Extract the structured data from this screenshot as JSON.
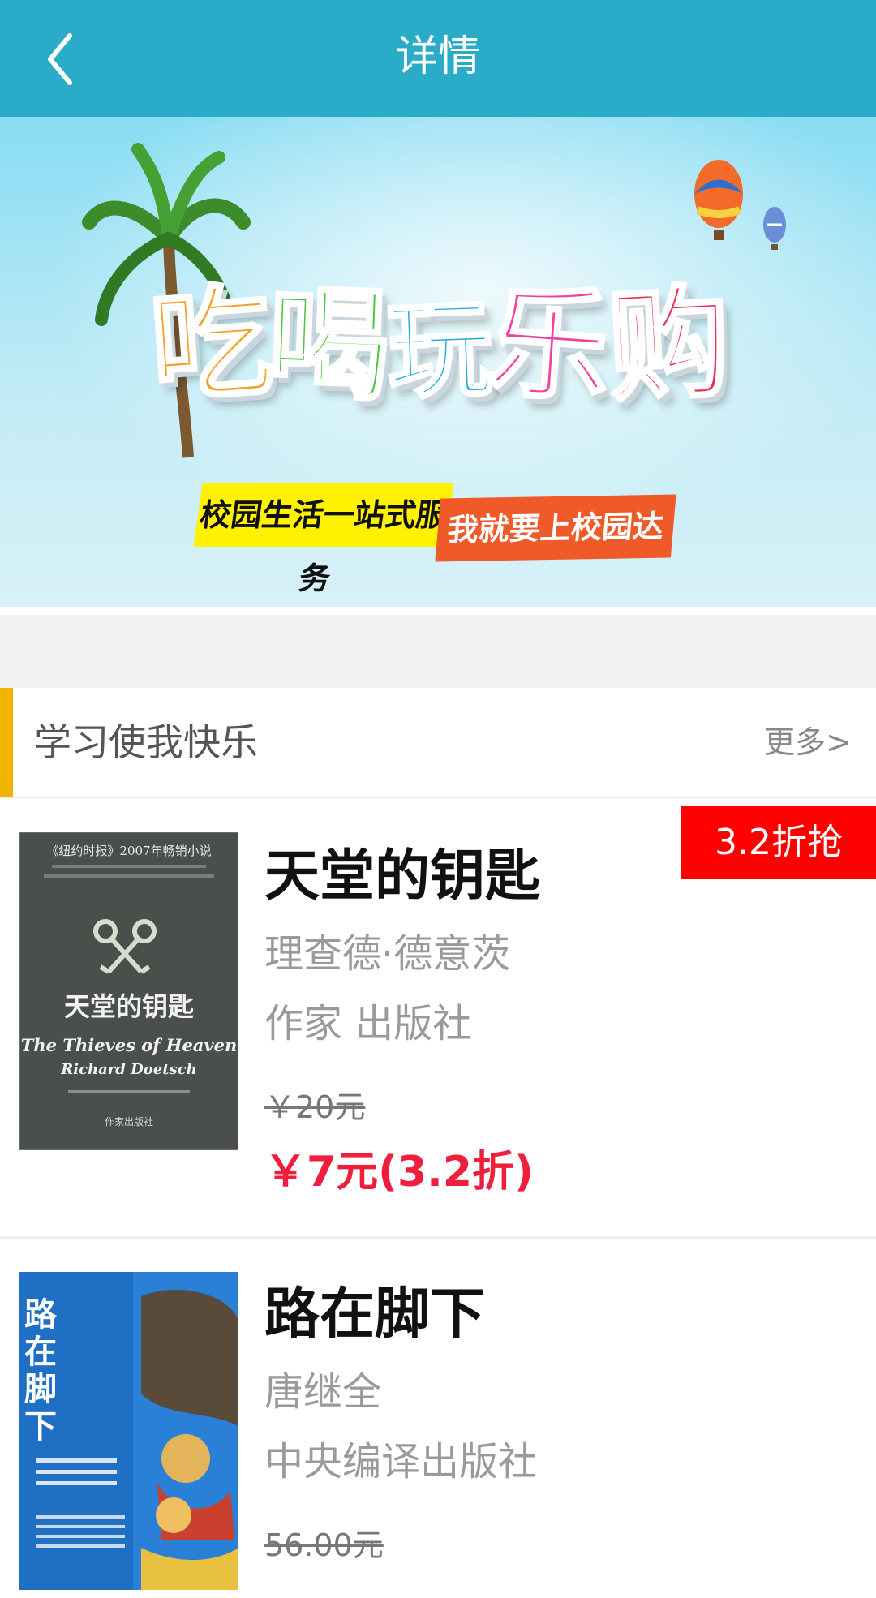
{
  "header": {
    "title": "详情",
    "back_icon": "chevron-left-icon",
    "background": "#2aacc8"
  },
  "banner": {
    "headline_chars": [
      "吃",
      "喝",
      "玩",
      "乐",
      "购"
    ],
    "slogan_left": "校园生活一站式服务",
    "slogan_right": "我就要上校园达"
  },
  "section": {
    "title": "学习使我快乐",
    "more_label": "更多>",
    "accent_color": "#f3b400"
  },
  "books": [
    {
      "title": "天堂的钥匙",
      "author": "理查德·德意茨",
      "publisher": "作家 出版社",
      "original_price": "￥20元",
      "sale_price": "￥7元(3.2折)",
      "badge": "3.2折抢",
      "cover": {
        "header_line1": "《纽约时报》2007年畅销小说",
        "title_cn": "天堂的钥匙",
        "title_en_line1": "The Thieves of Heaven",
        "title_en_line2": "Richard Doetsch",
        "publisher_mark": "作家出版社"
      }
    },
    {
      "title": "路在脚下",
      "author": "唐继全",
      "publisher": "中央编译出版社",
      "original_price": "56.00元",
      "cover": {
        "title_cn": "路在脚下"
      }
    }
  ],
  "colors": {
    "sale_red": "#ee1e3c",
    "badge_red": "#ff0000",
    "muted_gray": "#9a9a9a"
  }
}
